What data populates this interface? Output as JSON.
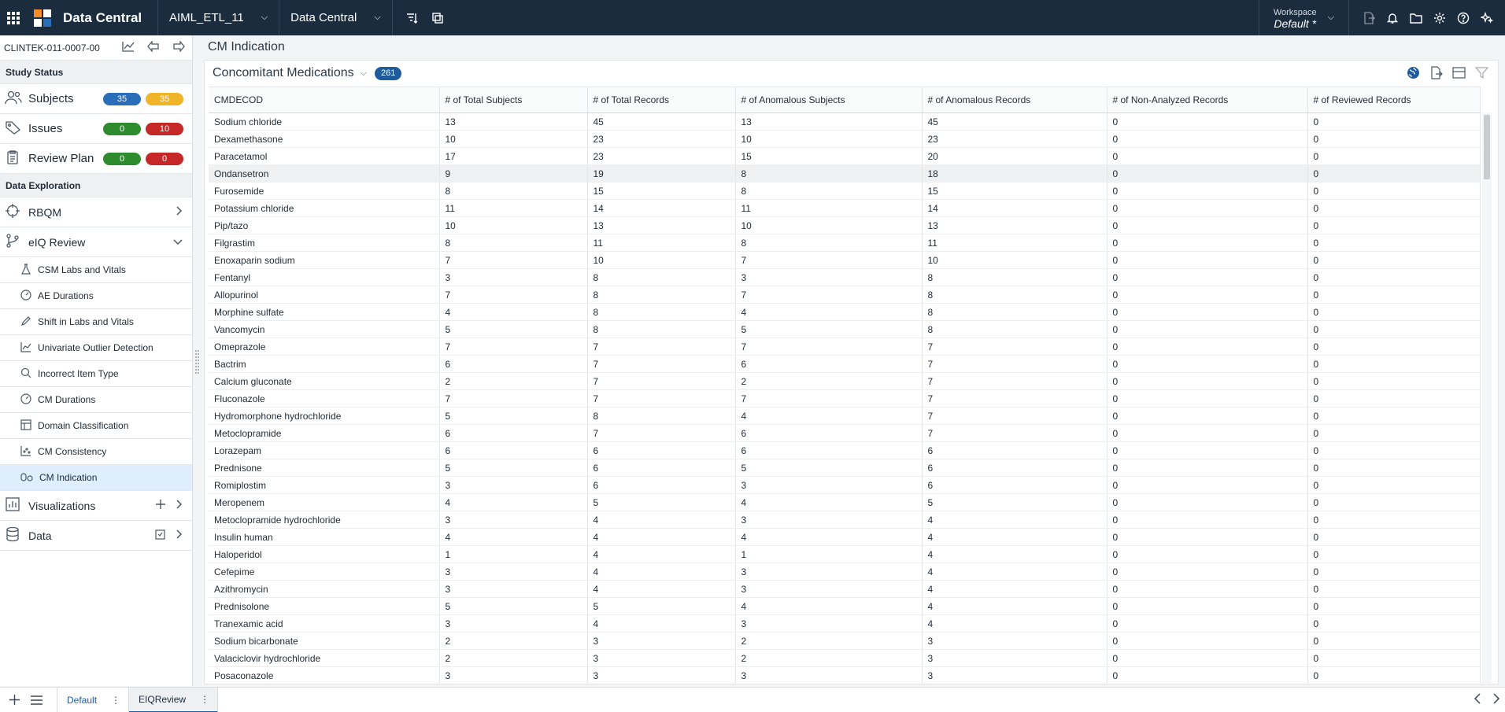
{
  "topbar": {
    "app_title": "Data Central",
    "project_select": "AIML_ETL_11",
    "module_select": "Data Central",
    "workspace_label": "Workspace",
    "workspace_value": "Default",
    "workspace_modified": "*"
  },
  "sidebar": {
    "study_id": "CLINTEK-011-0007-00",
    "study_status_header": "Study Status",
    "status": [
      {
        "label": "Subjects",
        "a": "35",
        "b": "35",
        "a_color": "#2a6db8",
        "b_color": "#f0b429"
      },
      {
        "label": "Issues",
        "a": "0",
        "b": "10",
        "a_color": "#2e8b2e",
        "b_color": "#c62828"
      },
      {
        "label": "Review Plan",
        "a": "0",
        "b": "0",
        "a_color": "#2e8b2e",
        "b_color": "#c62828"
      }
    ],
    "data_exploration_header": "Data Exploration",
    "rbqm": "RBQM",
    "eiq_review": "eIQ Review",
    "eiq_items": [
      "CSM Labs and Vitals",
      "AE Durations",
      "Shift in Labs and Vitals",
      "Univariate Outlier Detection",
      "Incorrect Item Type",
      "CM Durations",
      "Domain Classification",
      "CM Consistency",
      "CM Indication"
    ],
    "visualizations": "Visualizations",
    "data": "Data"
  },
  "page": {
    "title": "CM Indication",
    "panel_title": "Concomitant Medications",
    "count": "261"
  },
  "table": {
    "columns": [
      "CMDECOD",
      "# of Total Subjects",
      "# of Total Records",
      "# of Anomalous Subjects",
      "# of Anomalous Records",
      "# of Non-Analyzed Records",
      "# of Reviewed Records"
    ],
    "rows": [
      [
        "Sodium chloride",
        "13",
        "45",
        "13",
        "45",
        "0",
        "0"
      ],
      [
        "Dexamethasone",
        "10",
        "23",
        "10",
        "23",
        "0",
        "0"
      ],
      [
        "Paracetamol",
        "17",
        "23",
        "15",
        "20",
        "0",
        "0"
      ],
      [
        "Ondansetron",
        "9",
        "19",
        "8",
        "18",
        "0",
        "0"
      ],
      [
        "Furosemide",
        "8",
        "15",
        "8",
        "15",
        "0",
        "0"
      ],
      [
        "Potassium chloride",
        "11",
        "14",
        "11",
        "14",
        "0",
        "0"
      ],
      [
        "Pip/tazo",
        "10",
        "13",
        "10",
        "13",
        "0",
        "0"
      ],
      [
        "Filgrastim",
        "8",
        "11",
        "8",
        "11",
        "0",
        "0"
      ],
      [
        "Enoxaparin sodium",
        "7",
        "10",
        "7",
        "10",
        "0",
        "0"
      ],
      [
        "Fentanyl",
        "3",
        "8",
        "3",
        "8",
        "0",
        "0"
      ],
      [
        "Allopurinol",
        "7",
        "8",
        "7",
        "8",
        "0",
        "0"
      ],
      [
        "Morphine sulfate",
        "4",
        "8",
        "4",
        "8",
        "0",
        "0"
      ],
      [
        "Vancomycin",
        "5",
        "8",
        "5",
        "8",
        "0",
        "0"
      ],
      [
        "Omeprazole",
        "7",
        "7",
        "7",
        "7",
        "0",
        "0"
      ],
      [
        "Bactrim",
        "6",
        "7",
        "6",
        "7",
        "0",
        "0"
      ],
      [
        "Calcium gluconate",
        "2",
        "7",
        "2",
        "7",
        "0",
        "0"
      ],
      [
        "Fluconazole",
        "7",
        "7",
        "7",
        "7",
        "0",
        "0"
      ],
      [
        "Hydromorphone hydrochloride",
        "5",
        "8",
        "4",
        "7",
        "0",
        "0"
      ],
      [
        "Metoclopramide",
        "6",
        "7",
        "6",
        "7",
        "0",
        "0"
      ],
      [
        "Lorazepam",
        "6",
        "6",
        "6",
        "6",
        "0",
        "0"
      ],
      [
        "Prednisone",
        "5",
        "6",
        "5",
        "6",
        "0",
        "0"
      ],
      [
        "Romiplostim",
        "3",
        "6",
        "3",
        "6",
        "0",
        "0"
      ],
      [
        "Meropenem",
        "4",
        "5",
        "4",
        "5",
        "0",
        "0"
      ],
      [
        "Metoclopramide hydrochloride",
        "3",
        "4",
        "3",
        "4",
        "0",
        "0"
      ],
      [
        "Insulin human",
        "4",
        "4",
        "4",
        "4",
        "0",
        "0"
      ],
      [
        "Haloperidol",
        "1",
        "4",
        "1",
        "4",
        "0",
        "0"
      ],
      [
        "Cefepime",
        "3",
        "4",
        "3",
        "4",
        "0",
        "0"
      ],
      [
        "Azithromycin",
        "3",
        "4",
        "3",
        "4",
        "0",
        "0"
      ],
      [
        "Prednisolone",
        "5",
        "5",
        "4",
        "4",
        "0",
        "0"
      ],
      [
        "Tranexamic acid",
        "3",
        "4",
        "3",
        "4",
        "0",
        "0"
      ],
      [
        "Sodium bicarbonate",
        "2",
        "3",
        "2",
        "3",
        "0",
        "0"
      ],
      [
        "Valaciclovir hydrochloride",
        "2",
        "3",
        "2",
        "3",
        "0",
        "0"
      ],
      [
        "Posaconazole",
        "3",
        "3",
        "3",
        "3",
        "0",
        "0"
      ]
    ],
    "highlighted_row": 3
  },
  "bottombar": {
    "tabs": [
      "Default",
      "EIQReview"
    ],
    "active_tab": "EIQReview"
  },
  "colors": {
    "topbar": "#1b2c3f",
    "accent": "#1f5b9c",
    "active_nav": "#dfeefc"
  }
}
